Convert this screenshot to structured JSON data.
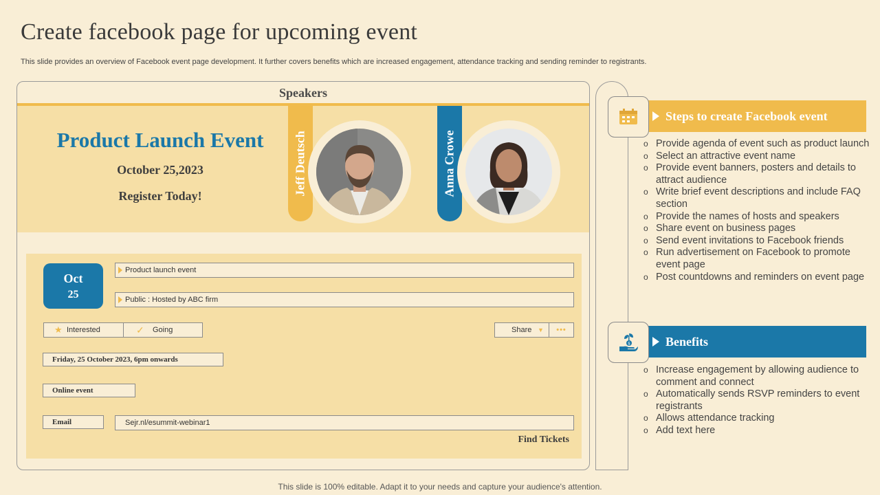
{
  "page": {
    "title": "Create facebook page for upcoming event",
    "subtitle": "This slide provides an overview of Facebook event page development. It further covers benefits which are increased engagement, attendance tracking and sending reminder to registrants.",
    "footer": "This slide is 100% editable. Adapt it to your needs and capture your audience's attention."
  },
  "event_card": {
    "header": "Speakers",
    "event_title": "Product Launch Event",
    "event_date": "October 25,2023",
    "register": "Register Today!",
    "speakers": [
      {
        "name": "Jeff Deutsch"
      },
      {
        "name": "Anna Crowe"
      }
    ],
    "date_box": {
      "month": "Oct",
      "day": "25"
    },
    "fields": {
      "event_name": "Product launch event",
      "hosted": "Public : Hosted by ABC firm",
      "link": "Sejr.nl/esummit-webinar1"
    },
    "buttons": {
      "interested": "Interested",
      "going": "Going",
      "share": "Share",
      "more": "•••"
    },
    "chips": {
      "datetime": "Friday, 25 October 2023, 6pm onwards",
      "online": "Online event",
      "email": "Email"
    },
    "find_tickets": "Find Tickets"
  },
  "steps": {
    "title": "Steps to create Facebook event",
    "items": [
      "Provide agenda of event such as product launch",
      "Select an attractive event name",
      "Provide event banners, posters and details to attract audience",
      "Write brief event descriptions and include FAQ section",
      "Provide the names of hosts and speakers",
      "Share event on business pages",
      "Send event invitations to Facebook friends",
      "Run advertisement on Facebook to promote event page",
      "Post countdowns and reminders on event page"
    ]
  },
  "benefits": {
    "title": "Benefits",
    "items": [
      "Increase engagement by allowing audience to comment and connect",
      "Automatically sends RSVP reminders to event registrants",
      "Allows attendance tracking",
      "Add text here"
    ]
  },
  "colors": {
    "yellow": "#f0bb4c",
    "blue": "#1b78a8",
    "cream": "#f9eed6",
    "light_yellow": "#f6dfa6"
  },
  "icons": {
    "steps": "calendar-icon",
    "benefits": "money-plant-hand-icon",
    "interested": "star-icon",
    "going": "check-icon",
    "share_dropdown": "triangle-down-icon"
  }
}
